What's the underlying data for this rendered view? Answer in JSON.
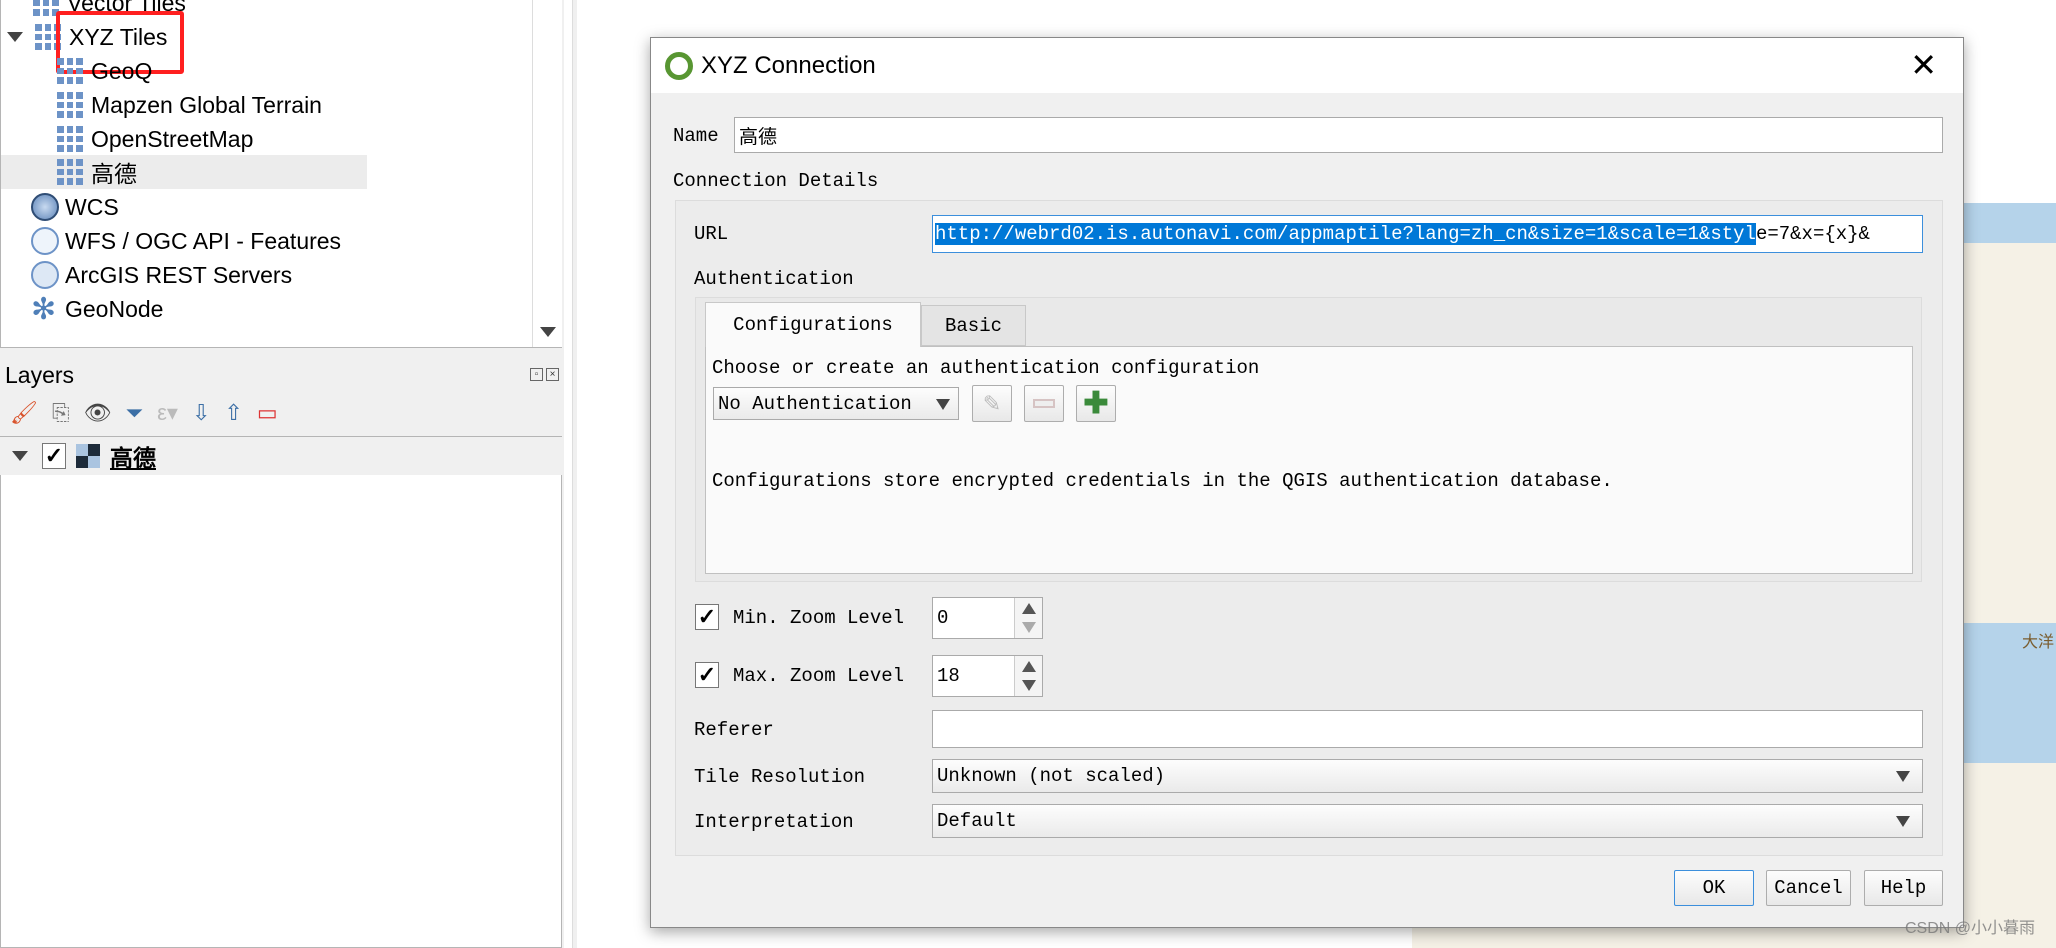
{
  "browser_tree": {
    "items": [
      {
        "label": "Vector Tiles",
        "icon": "vector-tiles-icon"
      },
      {
        "label": "XYZ Tiles",
        "icon": "xyz-tiles-icon",
        "expanded": true,
        "highlighted": true
      },
      {
        "label": "GeoQ",
        "icon": "xyz-tiles-icon"
      },
      {
        "label": "Mapzen Global Terrain",
        "icon": "xyz-tiles-icon"
      },
      {
        "label": "OpenStreetMap",
        "icon": "xyz-tiles-icon"
      },
      {
        "label": "高德",
        "icon": "xyz-tiles-icon",
        "selected": true
      },
      {
        "label": "WCS",
        "icon": "wcs-icon"
      },
      {
        "label": "WFS / OGC API - Features",
        "icon": "wfs-icon"
      },
      {
        "label": "ArcGIS REST Servers",
        "icon": "arcgis-icon"
      },
      {
        "label": "GeoNode",
        "icon": "geonode-icon"
      }
    ]
  },
  "layers": {
    "title": "Layers",
    "items": [
      {
        "label": "高德",
        "checked": true
      }
    ]
  },
  "map": {
    "label": "大洋"
  },
  "dialog": {
    "title": "XYZ Connection",
    "name_label": "Name",
    "name_value": "高德",
    "connection_details": "Connection Details",
    "url_label": "URL",
    "url_selected": "http://webrd02.is.autonavi.com/appmaptile?lang=zh_cn&size=1&scale=1&styl",
    "url_rest": "e=7&x={x}&",
    "authentication_label": "Authentication",
    "tabs": [
      {
        "label": "Configurations",
        "active": true
      },
      {
        "label": "Basic"
      }
    ],
    "choose_text": "Choose or create an authentication configuration",
    "auth_combo": "No Authentication",
    "auth_info": "Configurations store encrypted credentials in the QGIS authentication database.",
    "min_zoom_label": "Min. Zoom Level",
    "min_zoom_checked": true,
    "min_zoom": "0",
    "max_zoom_label": "Max. Zoom Level",
    "max_zoom_checked": true,
    "max_zoom": "18",
    "referer_label": "Referer",
    "referer_value": "",
    "tile_resolution_label": "Tile Resolution",
    "tile_resolution": "Unknown (not scaled)",
    "interpretation_label": "Interpretation",
    "interpretation": "Default",
    "ok": "OK",
    "cancel": "Cancel",
    "help": "Help"
  },
  "watermark": "CSDN @小小暮雨",
  "colors": {
    "highlight_box": "#ff2020",
    "selection": "#0078d7",
    "qgis_green": "#589632"
  }
}
